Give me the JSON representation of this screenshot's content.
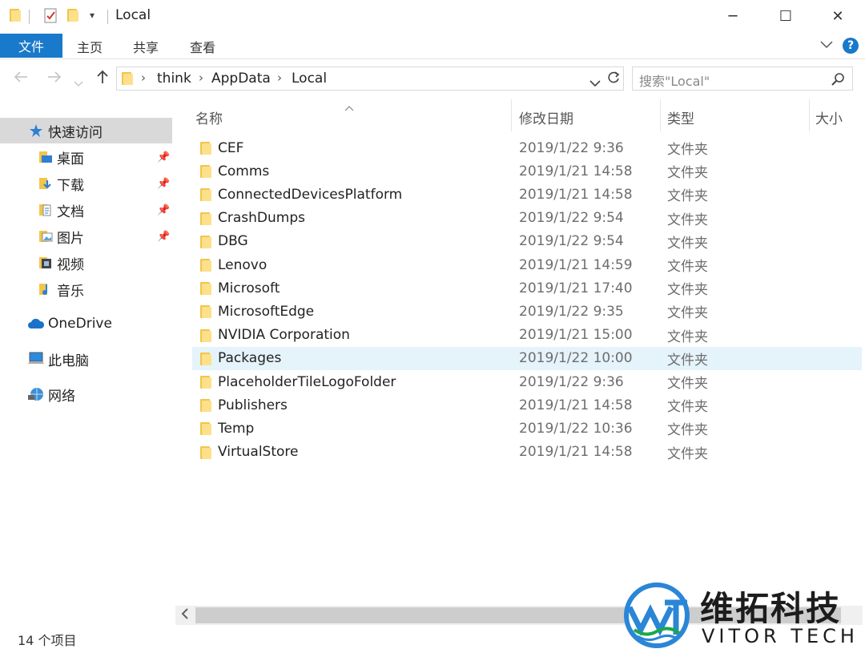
{
  "window": {
    "title": "Local",
    "controls": {
      "minimize": "─",
      "maximize": "☐",
      "close": "✕"
    }
  },
  "ribbon": {
    "tabs": [
      {
        "label": "文件",
        "active": true
      },
      {
        "label": "主页"
      },
      {
        "label": "共享"
      },
      {
        "label": "查看"
      }
    ],
    "help": "?"
  },
  "address": {
    "breadcrumbs": [
      "think",
      "AppData",
      "Local"
    ],
    "search_placeholder": "搜索\"Local\""
  },
  "sidebar": {
    "items": [
      {
        "label": "快速访问",
        "icon": "star-icon"
      },
      {
        "label": "桌面",
        "icon": "desktop-folder-icon",
        "pinned": true
      },
      {
        "label": "下载",
        "icon": "download-folder-icon",
        "pinned": true
      },
      {
        "label": "文档",
        "icon": "documents-folder-icon",
        "pinned": true
      },
      {
        "label": "图片",
        "icon": "pictures-folder-icon",
        "pinned": true
      },
      {
        "label": "视频",
        "icon": "video-folder-icon"
      },
      {
        "label": "音乐",
        "icon": "music-folder-icon"
      },
      {
        "label": "OneDrive",
        "icon": "cloud-icon"
      },
      {
        "label": "此电脑",
        "icon": "computer-icon"
      },
      {
        "label": "网络",
        "icon": "network-icon"
      }
    ]
  },
  "columns": [
    "名称",
    "修改日期",
    "类型",
    "大小"
  ],
  "files": [
    {
      "name": "CEF",
      "date": "2019/1/22 9:36",
      "type": "文件夹"
    },
    {
      "name": "Comms",
      "date": "2019/1/21 14:58",
      "type": "文件夹"
    },
    {
      "name": "ConnectedDevicesPlatform",
      "date": "2019/1/21 14:58",
      "type": "文件夹"
    },
    {
      "name": "CrashDumps",
      "date": "2019/1/22 9:54",
      "type": "文件夹"
    },
    {
      "name": "DBG",
      "date": "2019/1/22 9:54",
      "type": "文件夹"
    },
    {
      "name": "Lenovo",
      "date": "2019/1/21 14:59",
      "type": "文件夹"
    },
    {
      "name": "Microsoft",
      "date": "2019/1/21 17:40",
      "type": "文件夹"
    },
    {
      "name": "MicrosoftEdge",
      "date": "2019/1/22 9:35",
      "type": "文件夹"
    },
    {
      "name": "NVIDIA Corporation",
      "date": "2019/1/21 15:00",
      "type": "文件夹"
    },
    {
      "name": "Packages",
      "date": "2019/1/22 10:00",
      "type": "文件夹",
      "highlighted": true
    },
    {
      "name": "PlaceholderTileLogoFolder",
      "date": "2019/1/22 9:36",
      "type": "文件夹"
    },
    {
      "name": "Publishers",
      "date": "2019/1/21 14:58",
      "type": "文件夹"
    },
    {
      "name": "Temp",
      "date": "2019/1/22 10:36",
      "type": "文件夹"
    },
    {
      "name": "VirtualStore",
      "date": "2019/1/21 14:58",
      "type": "文件夹"
    }
  ],
  "status": {
    "item_count": "14 个项目"
  },
  "watermark": {
    "cn": "维拓科技",
    "en": "VITOR TECH"
  },
  "colors": {
    "accent": "#1979ca",
    "folder": "#f2c54b",
    "highlight": "#e5f3fb"
  }
}
